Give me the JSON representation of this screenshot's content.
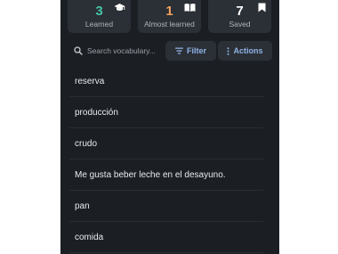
{
  "stats": [
    {
      "value": "3",
      "label": "Learned",
      "color": "#46c3a6",
      "icon": "graduation-cap-icon"
    },
    {
      "value": "1",
      "label": "Almost learned",
      "color": "#f0a35e",
      "icon": "open-book-icon"
    },
    {
      "value": "7",
      "label": "Saved",
      "color": "#ffffff",
      "icon": "bookmark-icon"
    }
  ],
  "search": {
    "placeholder": "Search vocabulary..."
  },
  "toolbar": {
    "filter_label": "Filter",
    "actions_label": "Actions"
  },
  "vocabulary": [
    "reserva",
    "producción",
    "crudo",
    "Me gusta beber leche en el desayuno.",
    "pan",
    "comida"
  ],
  "colors": {
    "background": "#1b1e23",
    "card": "#2b2f36",
    "accent": "#8fb4e6"
  }
}
